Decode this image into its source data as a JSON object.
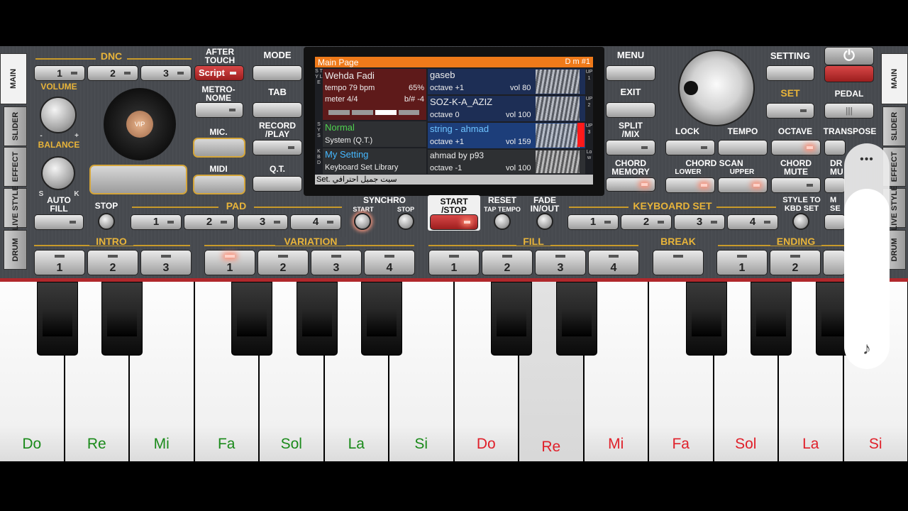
{
  "left": {
    "dnc_label": "DNC",
    "dnc_buttons": [
      "1",
      "2",
      "3"
    ],
    "script_label": "Script",
    "after_touch": "AFTER\nTOUCH",
    "volume": "VOLUME",
    "balance": "BALANCE",
    "knob_minus": "-",
    "knob_plus": "+",
    "knob_s": "S",
    "knob_k": "K",
    "metronome": "METRO-\nNOME",
    "mic": "MIC.",
    "midi": "MIDI",
    "vip_label": "VIP",
    "auto_fill": "AUTO\nFILL",
    "stop": "STOP",
    "pad": "PAD",
    "pad_buttons": [
      "1",
      "2",
      "3",
      "4"
    ]
  },
  "center_buttons": {
    "mode": "MODE",
    "tab": "TAB",
    "record_play": "RECORD\n/PLAY",
    "qt": "Q.T.",
    "menu": "MENU",
    "exit": "EXIT",
    "split_mix": "SPLIT\n/MIX",
    "chord_memory": "CHORD\nMEMORY"
  },
  "screen": {
    "title": "Main Page",
    "chord": "D m #1",
    "style_name": "Wehda Fadi",
    "tempo": "tempo 79 bpm",
    "percent": "65%",
    "meter": "meter 4/4",
    "transpose": "b/# -4",
    "sys_name": "Normal",
    "sys_sub": "System (Q.T.)",
    "kbd_name": "My Setting",
    "kbd_sub": "Keyboard Set Library",
    "set_text": "Set. سيت جميل احترافي",
    "side_style": "S T Y L E",
    "side_sys": "S Y S",
    "side_kbd": "K B D",
    "up1_label": "UP 1",
    "up2_label": "UP 2",
    "up3_label": "UP 3",
    "low_label": "Low",
    "parts": [
      {
        "name": "gaseb",
        "octave": "octave +1",
        "vol": "vol 80"
      },
      {
        "name": "SOZ-K-A_AZIZ",
        "octave": "octave  0",
        "vol": "vol 100"
      },
      {
        "name": "string - ahmad",
        "octave": "octave +1",
        "vol": "vol 159"
      },
      {
        "name": "ahmad by p93",
        "octave": "octave -1",
        "vol": "vol 100"
      }
    ]
  },
  "right": {
    "setting": "SETTING",
    "set": "SET",
    "pedal": "PEDAL",
    "lock": "LOCK",
    "tempo": "TEMPO",
    "octave": "OCTAVE",
    "transpose": "TRANSPOSE",
    "chord_scan": "CHORD SCAN",
    "lower": "LOWER",
    "upper": "UPPER",
    "chord_mute": "CHORD\nMUTE",
    "drum_mute": "DR\nMU",
    "keyboard_set": "KEYBOARD SET",
    "kbd_buttons": [
      "1",
      "2",
      "3",
      "4"
    ],
    "style_to_kbd": "STYLE TO\nKBD SET",
    "m_set": "M\nSE",
    "power_icon": "⏻"
  },
  "transport": {
    "synchro": "SYNCHRO",
    "synchro_start": "START",
    "synchro_stop": "STOP",
    "start_stop": "START\n/STOP",
    "reset": "RESET",
    "tap_tempo": "TAP TEMPO",
    "fade": "FADE\nIN/OUT"
  },
  "bottom_row": {
    "intro": "INTRO",
    "intro_buttons": [
      "1",
      "2",
      "3"
    ],
    "variation": "VARIATION",
    "variation_buttons": [
      "1",
      "2",
      "3",
      "4"
    ],
    "fill": "FILL",
    "fill_buttons": [
      "1",
      "2",
      "3",
      "4"
    ],
    "break": "BREAK",
    "ending": "ENDING",
    "ending_buttons": [
      "1",
      "2"
    ]
  },
  "side_tabs_left": [
    "MAIN",
    "SLIDER",
    "EFFECT",
    "LIVE STYLE",
    "DRUM"
  ],
  "side_tabs_right": [
    "MAIN",
    "SLIDER",
    "EFFECT",
    "LIVE STYLE",
    "DRUM"
  ],
  "keys": [
    {
      "note": "Do",
      "color": "#1a8a1a"
    },
    {
      "note": "Re",
      "color": "#1a8a1a"
    },
    {
      "note": "Mi",
      "color": "#1a8a1a"
    },
    {
      "note": "Fa",
      "color": "#1a8a1a"
    },
    {
      "note": "Sol",
      "color": "#1a8a1a"
    },
    {
      "note": "La",
      "color": "#1a8a1a"
    },
    {
      "note": "Si",
      "color": "#1a8a1a"
    },
    {
      "note": "Do",
      "color": "#e0202a"
    },
    {
      "note": "Re",
      "color": "#e0202a"
    },
    {
      "note": "Mi",
      "color": "#e0202a"
    },
    {
      "note": "Fa",
      "color": "#e0202a"
    },
    {
      "note": "Sol",
      "color": "#e0202a"
    },
    {
      "note": "La",
      "color": "#e0202a"
    },
    {
      "note": "Si",
      "color": "#e0202a"
    }
  ],
  "pressed_key_index": 8,
  "volume_overlay": {
    "menu_icon": "•••",
    "sound_icon": "♪"
  }
}
